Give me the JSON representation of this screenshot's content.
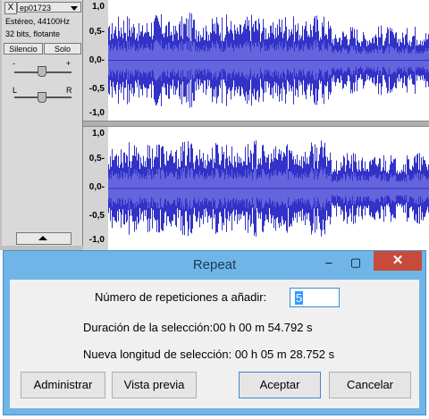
{
  "track": {
    "close_label": "X",
    "name": "ep01723",
    "info_line1": "Estéreo, 44100Hz",
    "info_line2": "32 bits, flotante",
    "mute_label": "Silencio",
    "solo_label": "Solo",
    "gain_minus": "-",
    "gain_plus": "+",
    "pan_left": "L",
    "pan_right": "R"
  },
  "ruler": {
    "ticks": [
      "1,0",
      "0,5-",
      "0,0-",
      "-0,5",
      "-1,0"
    ]
  },
  "colors": {
    "waveform": "#3232c8",
    "waveform_rms": "#6464dc",
    "dialog_title": "#1d3b57",
    "close": "#c74b3b"
  },
  "dialog": {
    "title": "Repeat",
    "minimize_icon": "‒",
    "maximize_icon": "▢",
    "close_icon": "✕",
    "repeat_label": "Número de repeticiones a añadir:",
    "repeat_value": "5",
    "selection_duration": "Duración de la selección:00 h 00 m 54.792 s",
    "new_length": "Nueva longitud de selección: 00 h 05 m 28.752 s",
    "buttons": {
      "manage": "Administrar",
      "preview": "Vista previa",
      "ok": "Aceptar",
      "cancel": "Cancelar"
    }
  }
}
